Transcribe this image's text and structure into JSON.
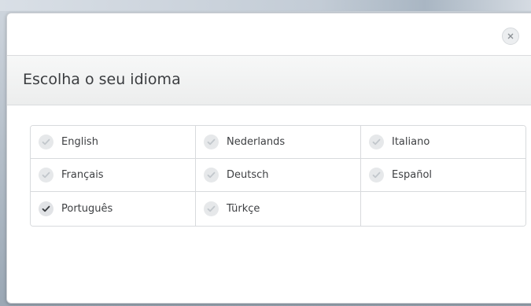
{
  "dialog": {
    "title": "Escolha o seu idioma",
    "close_icon": "close-icon",
    "languages": [
      {
        "label": "English",
        "selected": false
      },
      {
        "label": "Nederlands",
        "selected": false
      },
      {
        "label": "Italiano",
        "selected": false
      },
      {
        "label": "Français",
        "selected": false
      },
      {
        "label": "Deutsch",
        "selected": false
      },
      {
        "label": "Español",
        "selected": false
      },
      {
        "label": "Português",
        "selected": true
      },
      {
        "label": "Türkçe",
        "selected": false
      }
    ]
  },
  "colors": {
    "selected_check": "#3a3d40",
    "unselected_check": "#c2c7cc",
    "header_background": "#eceded"
  }
}
